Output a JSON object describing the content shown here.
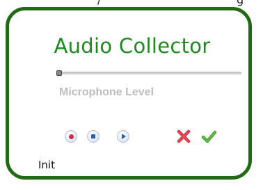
{
  "app": {
    "title": "Audio Collector"
  },
  "slider": {
    "label": "Microphone Level",
    "level": 0.0
  },
  "controls": {
    "record_icon": "record-icon",
    "stop_icon": "stop-icon",
    "play_icon": "play-icon",
    "cancel_icon": "cancel-x-icon",
    "accept_icon": "checkmark-icon"
  },
  "status": {
    "text": "Init"
  },
  "colors": {
    "border": "#1f6a12",
    "title": "#1d8a1d",
    "label": "#bdbdbd",
    "record": "#d22a4a",
    "media": "#2a5db0",
    "cancel": "#d6343f",
    "accept": "#4aa630"
  }
}
